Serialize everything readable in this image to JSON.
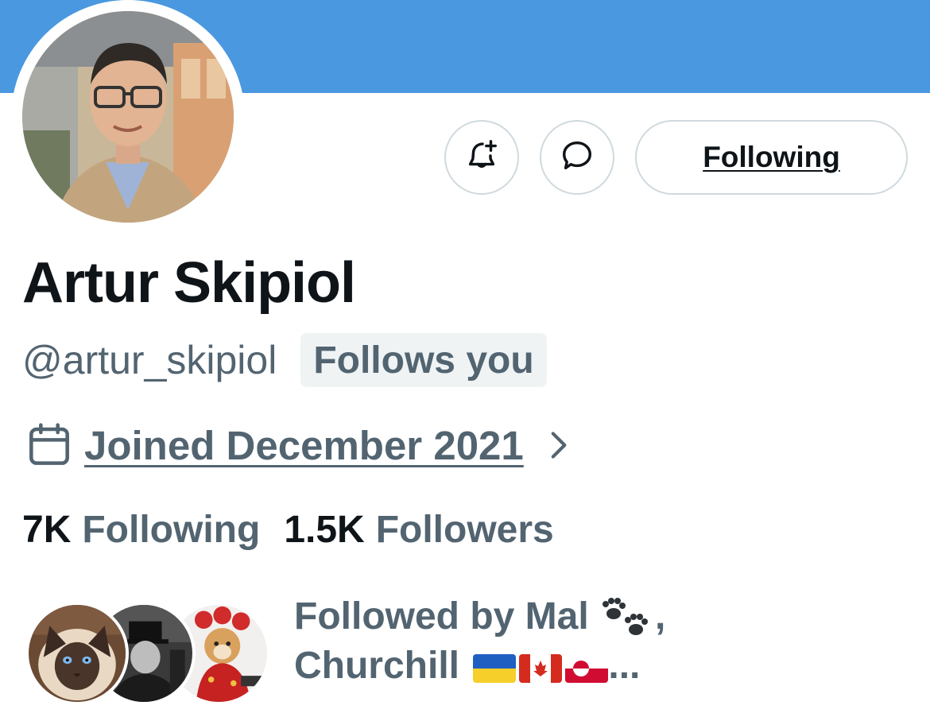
{
  "profile": {
    "display_name": "Artur Skipiol",
    "handle": "@artur_skipiol",
    "follows_you_badge": "Follows you",
    "joined": "Joined December 2021"
  },
  "actions": {
    "following_button": "Following"
  },
  "stats": {
    "following_count": "7K",
    "following_label": "Following",
    "followers_count": "1.5K",
    "followers_label": "Followers"
  },
  "followed_by": {
    "prefix": "Followed by Mal",
    "separator": ",",
    "second_name": "Churchill",
    "ellipsis": "..."
  },
  "icons": {
    "notify": "bell-plus-icon",
    "message": "chat-bubble-icon",
    "calendar": "calendar-icon",
    "chevron": "chevron-right-icon",
    "paws": "paw-prints-icon"
  },
  "colors": {
    "banner": "#4a98e0",
    "secondary_text": "#536471",
    "primary_text": "#0f1419",
    "border": "#cfd9de",
    "badge_bg": "#eff3f4"
  }
}
